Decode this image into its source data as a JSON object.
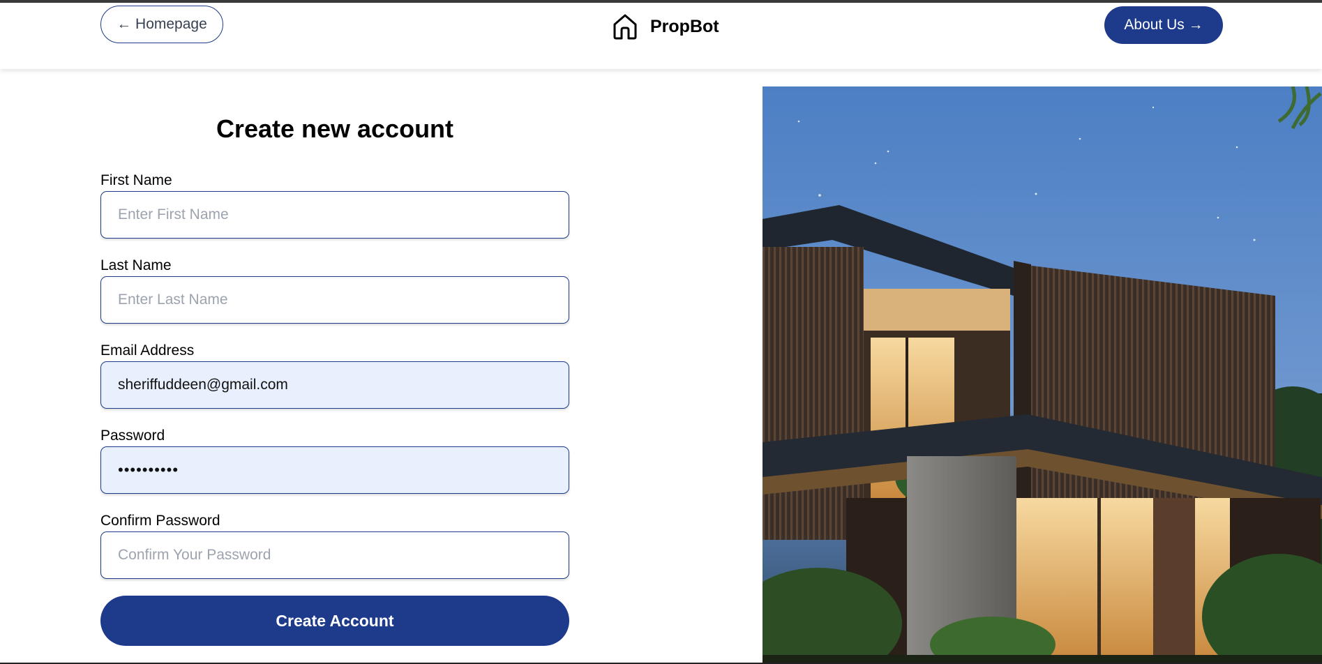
{
  "nav": {
    "home_label": "← Homepage",
    "brand": "PropBot",
    "about_label": "About Us →"
  },
  "form": {
    "title": "Create new account",
    "first_name": {
      "label": "First Name",
      "placeholder": "Enter First Name",
      "value": ""
    },
    "last_name": {
      "label": "Last Name",
      "placeholder": "Enter Last Name",
      "value": ""
    },
    "email": {
      "label": "Email Address",
      "placeholder": "",
      "value": "sheriffuddeen@gmail.com"
    },
    "password": {
      "label": "Password",
      "value": "••••••••••"
    },
    "confirm_password": {
      "label": "Confirm Password",
      "placeholder": "Confirm Your Password",
      "value": ""
    },
    "submit_label": "Create Account"
  },
  "colors": {
    "accent": "#1e3a8a",
    "autofill_bg": "#e8f0fe",
    "placeholder": "#9ca3af"
  },
  "icons": {
    "brand_icon": "house-icon"
  }
}
